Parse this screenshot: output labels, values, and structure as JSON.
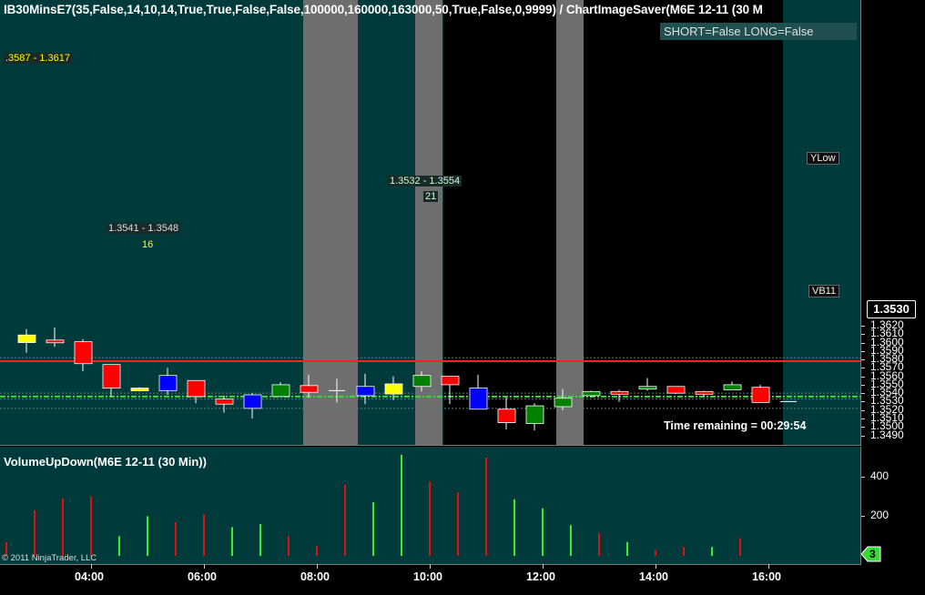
{
  "window": {
    "title": "IB30MinsE7(35,False,14,10,14,True,True,False,False,100000,160000,163000,50,True,False,0,9999)  /  ChartImageSaver(M6E  12-11  (30  M",
    "status": "SHORT=False LONG=False",
    "time_remaining": "Time remaining = 00:29:54",
    "volume_title": "VolumeUpDown(M6E 12-11 (30 Min))",
    "copyright": "© 2011 NinjaTrader, LLC",
    "last_price": "1.3530",
    "volume_badge": "3"
  },
  "annotations": {
    "range1": ".3587 - 1.3617",
    "range2": "1.3541 - 1.3548",
    "range2_count": "16",
    "range3": "1.3532 - 1.3554",
    "range3_count": "21",
    "ylow": "YLow",
    "vb": "VB11"
  },
  "colors": {
    "background": "#003a3a",
    "up": "#008000",
    "down": "#ff0000",
    "neutral_yellow": "#ffff00",
    "neutral_blue": "#0000ff",
    "ylow_line": "#ff2020",
    "vb_line": "#33dd33",
    "session_black": "#000000",
    "gray_band": "#6e6e6e"
  },
  "chart_data": [
    {
      "type": "candlestick",
      "title": "IB30MinsE7(35,False,14,10,14,True,True,False,False,100000,160000,163000,50,True,False,0,9999)  /  ChartImageSaver(M6E  12-11  (30  M",
      "x_ticks": [
        "04:00",
        "06:00",
        "08:00",
        "10:00",
        "12:00",
        "14:00",
        "16:00"
      ],
      "y_ticks": [
        "1.3490",
        "1.3500",
        "1.3510",
        "1.3520",
        "1.3530",
        "1.3540",
        "1.3550",
        "1.3560",
        "1.3570",
        "1.3580",
        "1.3590",
        "1.3600",
        "1.3610",
        "1.3620"
      ],
      "ylim": [
        1.3488,
        1.3625
      ],
      "reference_lines": [
        {
          "name": "YLow",
          "value": 1.3578
        },
        {
          "name": "VB11",
          "value": 1.3536
        }
      ],
      "candles": [
        {
          "time": "03:00",
          "open": 1.36,
          "high": 1.3616,
          "low": 1.3588,
          "close": 1.3609,
          "color": "yellow"
        },
        {
          "time": "03:30",
          "open": 1.3603,
          "high": 1.3618,
          "low": 1.3595,
          "close": 1.36,
          "color": "red"
        },
        {
          "time": "04:00",
          "open": 1.3601,
          "high": 1.3604,
          "low": 1.3566,
          "close": 1.3575,
          "color": "red"
        },
        {
          "time": "04:30",
          "open": 1.3574,
          "high": 1.3569,
          "low": 1.3536,
          "close": 1.3546,
          "color": "red"
        },
        {
          "time": "05:00",
          "open": 1.3546,
          "high": 1.3547,
          "low": 1.3542,
          "close": 1.3543,
          "color": "yellow"
        },
        {
          "time": "05:30",
          "open": 1.3543,
          "high": 1.357,
          "low": 1.3538,
          "close": 1.3561,
          "color": "blue"
        },
        {
          "time": "06:00",
          "open": 1.3555,
          "high": 1.3555,
          "low": 1.3528,
          "close": 1.3536,
          "color": "red"
        },
        {
          "time": "06:30",
          "open": 1.3533,
          "high": 1.3537,
          "low": 1.3517,
          "close": 1.3527,
          "color": "red"
        },
        {
          "time": "07:00",
          "open": 1.3522,
          "high": 1.354,
          "low": 1.351,
          "close": 1.3538,
          "color": "blue"
        },
        {
          "time": "07:30",
          "open": 1.3536,
          "high": 1.3553,
          "low": 1.3536,
          "close": 1.355,
          "color": "green"
        },
        {
          "time": "08:00",
          "open": 1.3549,
          "high": 1.3562,
          "low": 1.3535,
          "close": 1.3541,
          "color": "red"
        },
        {
          "time": "08:30",
          "open": 1.3543,
          "high": 1.3557,
          "low": 1.3529,
          "close": 1.3543,
          "color": "neutral"
        },
        {
          "time": "09:00",
          "open": 1.3537,
          "high": 1.3563,
          "low": 1.3527,
          "close": 1.3548,
          "color": "blue"
        },
        {
          "time": "09:30",
          "open": 1.3539,
          "high": 1.356,
          "low": 1.3532,
          "close": 1.3551,
          "color": "yellow"
        },
        {
          "time": "10:00",
          "open": 1.3548,
          "high": 1.3566,
          "low": 1.3542,
          "close": 1.3561,
          "color": "green"
        },
        {
          "time": "10:30",
          "open": 1.356,
          "high": 1.356,
          "low": 1.3527,
          "close": 1.355,
          "color": "red"
        },
        {
          "time": "11:00",
          "open": 1.3546,
          "high": 1.3562,
          "low": 1.3521,
          "close": 1.3521,
          "color": "blue"
        },
        {
          "time": "11:30",
          "open": 1.3521,
          "high": 1.3535,
          "low": 1.3497,
          "close": 1.3505,
          "color": "red"
        },
        {
          "time": "12:00",
          "open": 1.3504,
          "high": 1.3528,
          "low": 1.3496,
          "close": 1.3525,
          "color": "green"
        },
        {
          "time": "12:30",
          "open": 1.3524,
          "high": 1.3545,
          "low": 1.352,
          "close": 1.3534,
          "color": "green"
        },
        {
          "time": "13:00",
          "open": 1.3537,
          "high": 1.3543,
          "low": 1.3535,
          "close": 1.3542,
          "color": "green"
        },
        {
          "time": "13:30",
          "open": 1.3542,
          "high": 1.3544,
          "low": 1.353,
          "close": 1.3541,
          "color": "red"
        },
        {
          "time": "14:00",
          "open": 1.3547,
          "high": 1.3558,
          "low": 1.3543,
          "close": 1.3548,
          "color": "green"
        },
        {
          "time": "14:30",
          "open": 1.3548,
          "high": 1.3548,
          "low": 1.3539,
          "close": 1.354,
          "color": "red"
        },
        {
          "time": "15:00",
          "open": 1.3542,
          "high": 1.3543,
          "low": 1.3536,
          "close": 1.3541,
          "color": "red"
        },
        {
          "time": "15:30",
          "open": 1.3544,
          "high": 1.3554,
          "low": 1.3544,
          "close": 1.355,
          "color": "green"
        },
        {
          "time": "16:00",
          "open": 1.3547,
          "high": 1.355,
          "low": 1.3529,
          "close": 1.3529,
          "color": "red"
        },
        {
          "time": "16:30",
          "open": 1.353,
          "high": 1.353,
          "low": 1.353,
          "close": 1.353,
          "color": "neutral"
        }
      ]
    },
    {
      "type": "bar",
      "title": "VolumeUpDown(M6E 12-11 (30 Min))",
      "y_ticks": [
        "200",
        "400"
      ],
      "ylim": [
        0,
        520
      ],
      "bars": [
        {
          "time": "03:00",
          "value": 70,
          "color": "red"
        },
        {
          "time": "03:30",
          "value": 230,
          "color": "red"
        },
        {
          "time": "04:00",
          "value": 290,
          "color": "red"
        },
        {
          "time": "04:30",
          "value": 300,
          "color": "red"
        },
        {
          "time": "05:00",
          "value": 100,
          "color": "green"
        },
        {
          "time": "05:30",
          "value": 200,
          "color": "green"
        },
        {
          "time": "06:00",
          "value": 170,
          "color": "red"
        },
        {
          "time": "06:30",
          "value": 210,
          "color": "red"
        },
        {
          "time": "07:00",
          "value": 145,
          "color": "green"
        },
        {
          "time": "07:30",
          "value": 160,
          "color": "green"
        },
        {
          "time": "08:00",
          "value": 100,
          "color": "red"
        },
        {
          "time": "08:30",
          "value": 50,
          "color": "red"
        },
        {
          "time": "09:00",
          "value": 360,
          "color": "red"
        },
        {
          "time": "09:30",
          "value": 270,
          "color": "green"
        },
        {
          "time": "10:00",
          "value": 510,
          "color": "green"
        },
        {
          "time": "10:30",
          "value": 375,
          "color": "red"
        },
        {
          "time": "11:00",
          "value": 320,
          "color": "red"
        },
        {
          "time": "11:30",
          "value": 495,
          "color": "red"
        },
        {
          "time": "12:00",
          "value": 285,
          "color": "green"
        },
        {
          "time": "12:30",
          "value": 240,
          "color": "green"
        },
        {
          "time": "13:00",
          "value": 155,
          "color": "green"
        },
        {
          "time": "13:30",
          "value": 115,
          "color": "red"
        },
        {
          "time": "14:00",
          "value": 70,
          "color": "green"
        },
        {
          "time": "14:30",
          "value": 30,
          "color": "red"
        },
        {
          "time": "15:00",
          "value": 45,
          "color": "red"
        },
        {
          "time": "15:30",
          "value": 45,
          "color": "green"
        },
        {
          "time": "16:00",
          "value": 90,
          "color": "red"
        }
      ]
    }
  ]
}
